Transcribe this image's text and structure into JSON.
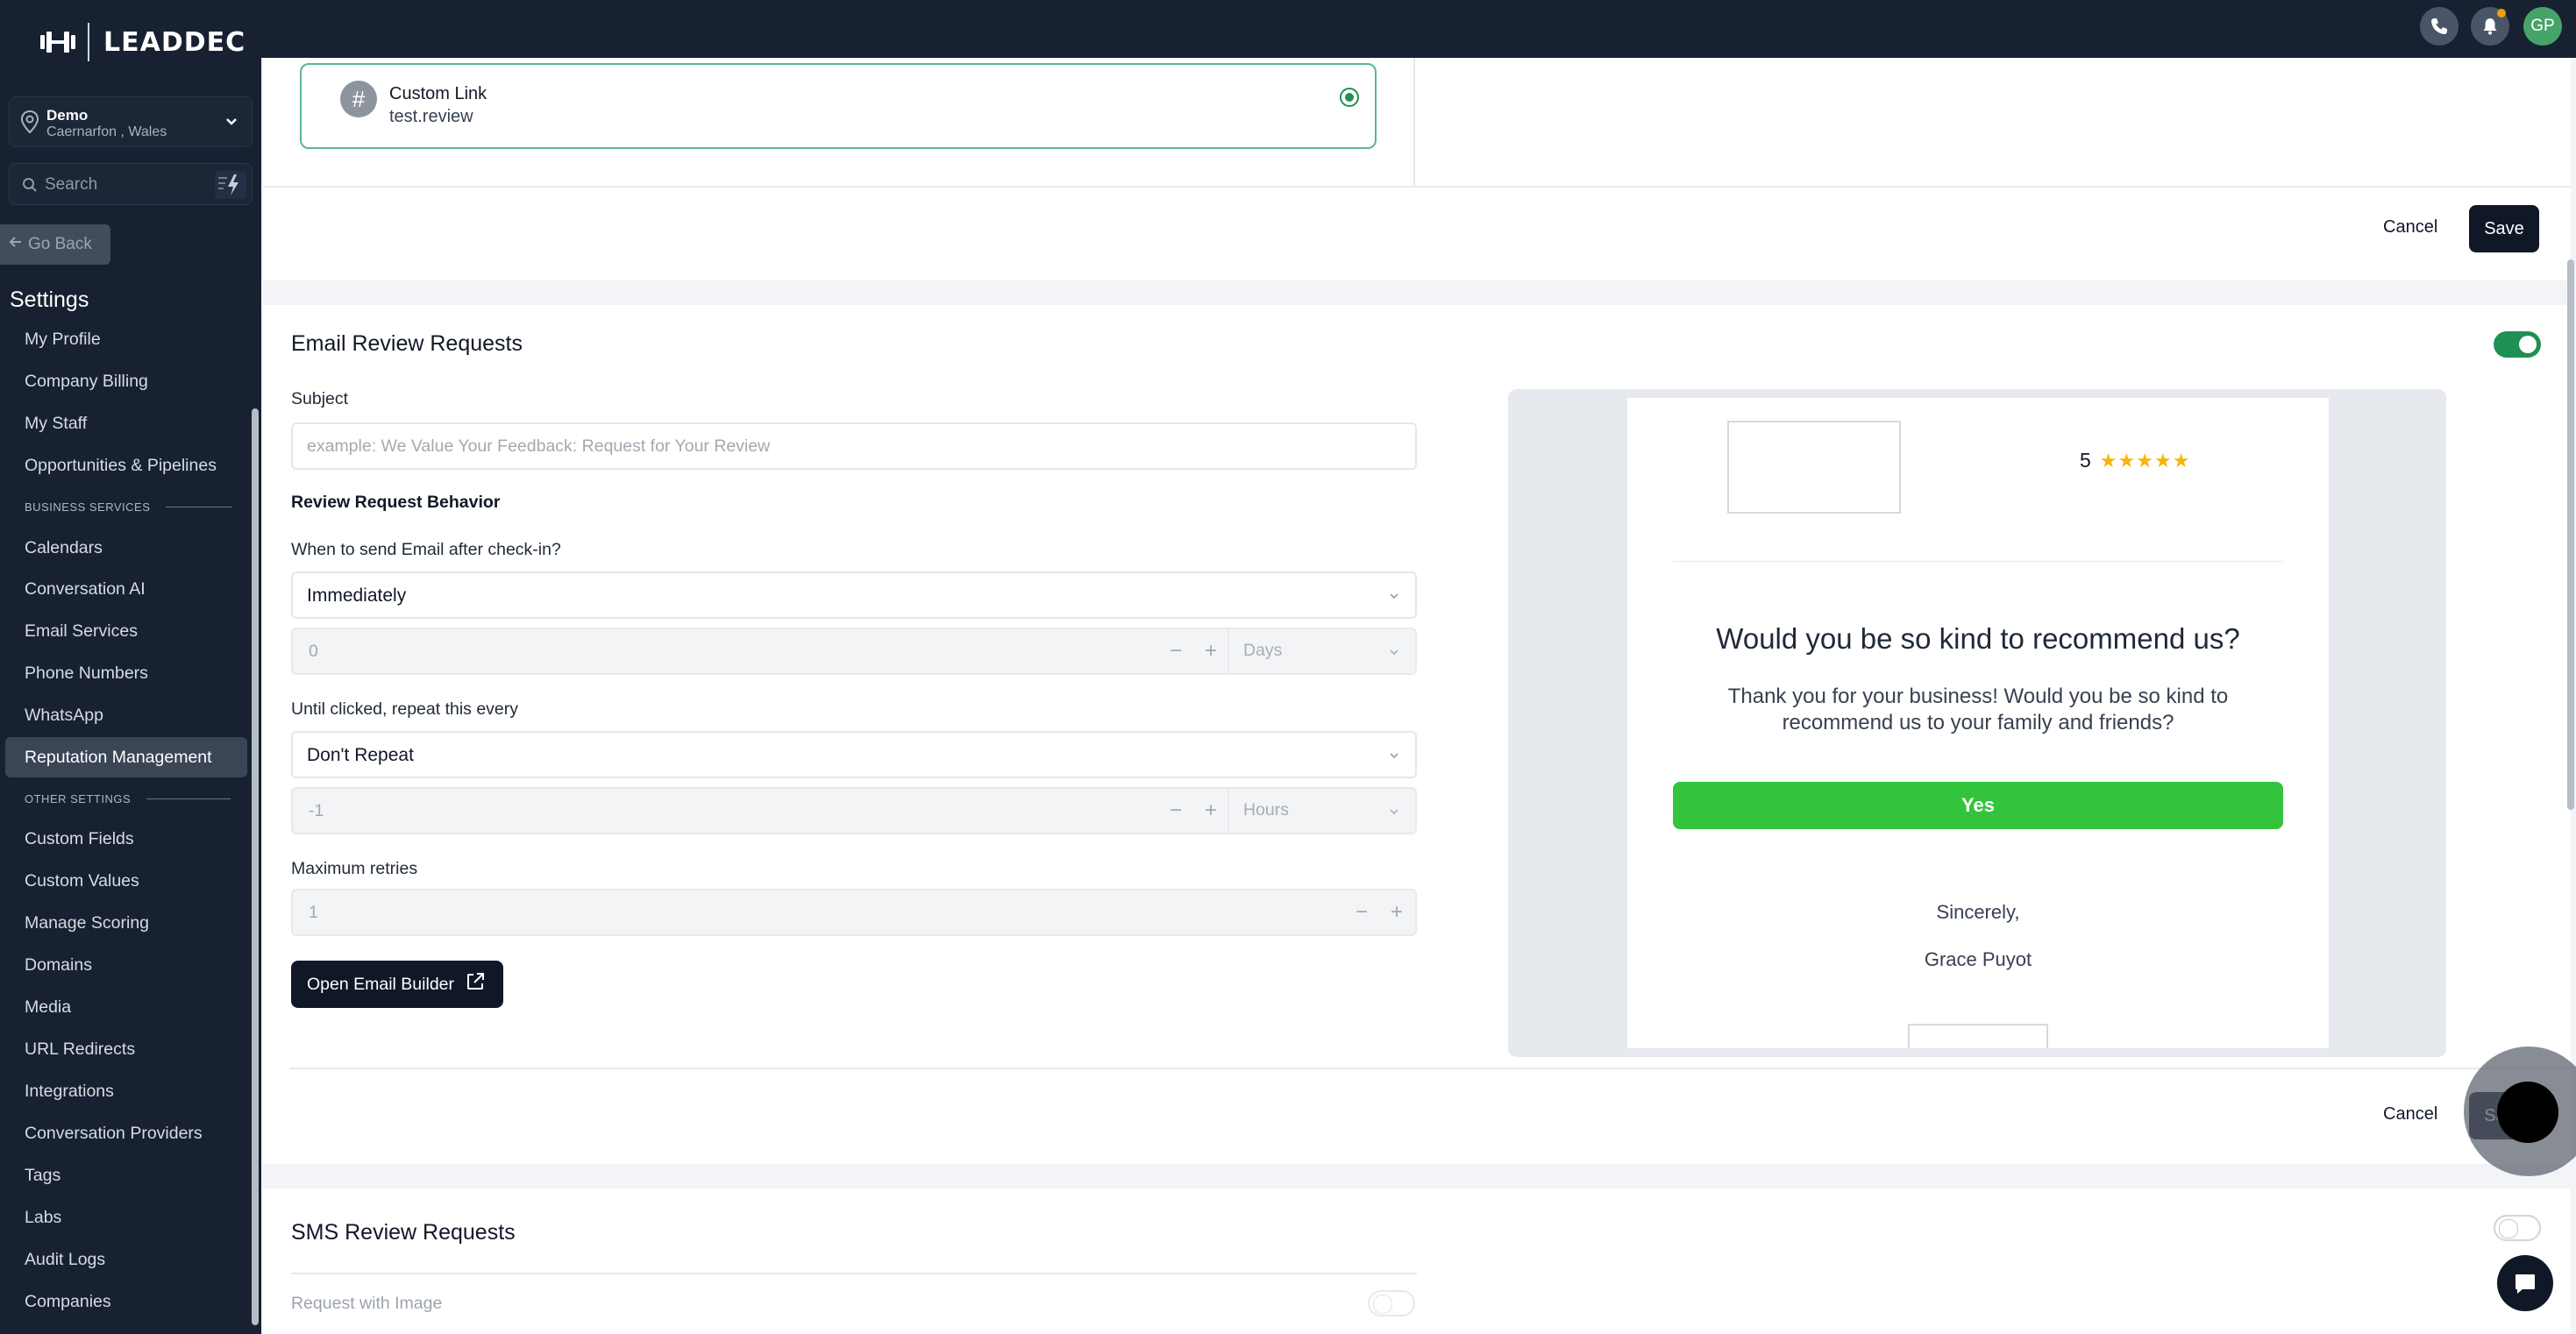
{
  "brand": {
    "name": "LEADDEC"
  },
  "location": {
    "name": "Demo",
    "address": "Caernarfon , Wales"
  },
  "sidebar_search": {
    "placeholder": "Search"
  },
  "go_back": "Go Back",
  "settings_title": "Settings",
  "nav": {
    "my_profile": "My Profile",
    "company_billing": "Company Billing",
    "my_staff": "My Staff",
    "opportunities": "Opportunities & Pipelines",
    "section_business": "BUSINESS SERVICES",
    "calendars": "Calendars",
    "conversation_ai": "Conversation AI",
    "email_services": "Email Services",
    "phone_numbers": "Phone Numbers",
    "whatsapp": "WhatsApp",
    "reputation": "Reputation Management",
    "section_other": "OTHER SETTINGS",
    "custom_fields": "Custom Fields",
    "custom_values": "Custom Values",
    "manage_scoring": "Manage Scoring",
    "domains": "Domains",
    "media": "Media",
    "url_redirects": "URL Redirects",
    "integrations": "Integrations",
    "conversation_providers": "Conversation Providers",
    "tags": "Tags",
    "labs": "Labs",
    "audit_logs": "Audit Logs",
    "companies": "Companies"
  },
  "topbar": {
    "avatar_initials": "GP"
  },
  "custom_link": {
    "title": "Custom Link",
    "value": "test.review",
    "selected": true
  },
  "actions": {
    "cancel": "Cancel",
    "save": "Save"
  },
  "email_section": {
    "title": "Email Review Requests",
    "enabled": true,
    "subject_label": "Subject",
    "subject_placeholder": "example: We Value Your Feedback: Request for Your Review",
    "behavior_heading": "Review Request Behavior",
    "when_label": "When to send Email after check-in?",
    "when_value": "Immediately",
    "delay_value": "0",
    "delay_unit": "Days",
    "repeat_label": "Until clicked, repeat this every",
    "repeat_value": "Don't Repeat",
    "repeat_interval": "-1",
    "repeat_unit": "Hours",
    "max_retries_label": "Maximum retries",
    "max_retries_value": "1",
    "builder_button": "Open Email Builder"
  },
  "email_preview": {
    "rating": "5",
    "stars": "★★★★★",
    "heading": "Would you be so kind to recommend us?",
    "body": "Thank you for your business! Would you be so kind to recommend us to your family and friends?",
    "button": "Yes",
    "closing": "Sincerely,",
    "signer": "Grace Puyot"
  },
  "sms_section": {
    "title": "SMS Review Requests",
    "enabled": false,
    "image_label": "Request with Image"
  },
  "colors": {
    "sidebar_bg": "#172131",
    "primary_button": "#101828",
    "toggle_on": "#1f8f54",
    "yes_button": "#34c33d",
    "star": "#f5b50a"
  }
}
